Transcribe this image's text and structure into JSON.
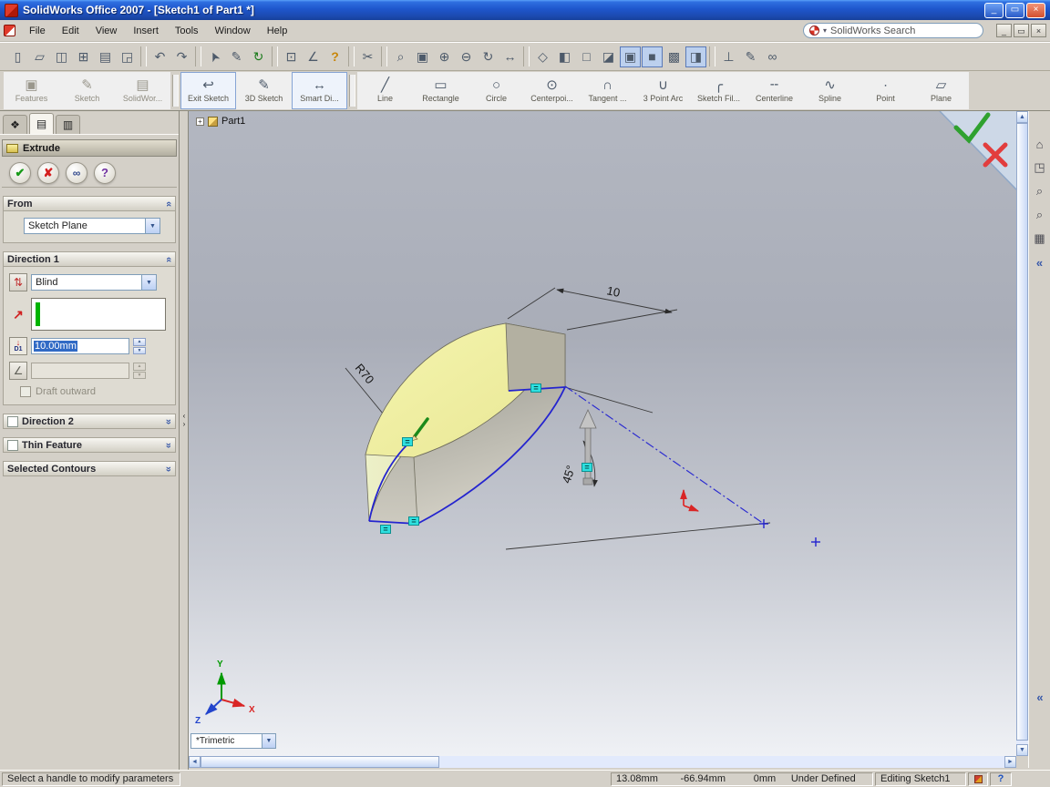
{
  "window": {
    "title": "SolidWorks Office 2007 - [Sketch1 of Part1 *]",
    "buttons": [
      {
        "name": "minimize-button",
        "glyph": "_"
      },
      {
        "name": "restore-button",
        "glyph": "▭"
      },
      {
        "name": "close-button",
        "glyph": "×",
        "cls": "close"
      }
    ]
  },
  "menu": {
    "items": [
      {
        "name": "menu-file",
        "label": "File"
      },
      {
        "name": "menu-edit",
        "label": "Edit"
      },
      {
        "name": "menu-view",
        "label": "View"
      },
      {
        "name": "menu-insert",
        "label": "Insert"
      },
      {
        "name": "menu-tools",
        "label": "Tools"
      },
      {
        "name": "menu-window",
        "label": "Window"
      },
      {
        "name": "menu-help",
        "label": "Help"
      }
    ]
  },
  "search": {
    "label": "SolidWorks Search",
    "arrow": "▾"
  },
  "mdi": {
    "buttons": [
      {
        "name": "mdi-minimize-button",
        "glyph": "_"
      },
      {
        "name": "mdi-restore-button",
        "glyph": "▭"
      },
      {
        "name": "mdi-close-button",
        "glyph": "×"
      }
    ]
  },
  "toolbar_main": {
    "icons": [
      {
        "name": "new-document-icon",
        "glyph": "▯"
      },
      {
        "name": "open-folder-icon",
        "glyph": "▱"
      },
      {
        "name": "save-icon",
        "glyph": "◫"
      },
      {
        "name": "save-all-icon",
        "glyph": "⊞"
      },
      {
        "name": "print-icon",
        "glyph": "▤"
      },
      {
        "name": "print-preview-icon",
        "glyph": "◲"
      },
      {
        "name": "separator",
        "sep": true
      },
      {
        "name": "undo-icon",
        "glyph": "↶"
      },
      {
        "name": "redo-icon",
        "glyph": "↷"
      },
      {
        "name": "separator",
        "sep": true
      },
      {
        "name": "select-pointer-icon",
        "glyph": "➤",
        "cls": "rotl"
      },
      {
        "name": "sketch-entity-icon",
        "glyph": "✎"
      },
      {
        "name": "rebuild-icon",
        "glyph": "↻",
        "cls": "green"
      },
      {
        "name": "separator",
        "sep": true
      },
      {
        "name": "options-icon",
        "glyph": "⊡"
      },
      {
        "name": "dimension-icon",
        "glyph": "∠"
      },
      {
        "name": "quick-help-icon",
        "glyph": "?",
        "cls": "gold"
      },
      {
        "name": "separator",
        "sep": true
      },
      {
        "name": "trim-icon",
        "glyph": "✂"
      },
      {
        "name": "separator",
        "sep": true
      },
      {
        "name": "zoom-fit-icon",
        "glyph": "⌕"
      },
      {
        "name": "zoom-area-icon",
        "glyph": "▣"
      },
      {
        "name": "zoom-in-icon",
        "glyph": "⊕"
      },
      {
        "name": "zoom-out-icon",
        "glyph": "⊖"
      },
      {
        "name": "rotate-view-icon",
        "glyph": "↻"
      },
      {
        "name": "pan-icon",
        "glyph": "↔"
      },
      {
        "name": "separator",
        "sep": true
      },
      {
        "name": "view-orientation-icon",
        "glyph": "◇"
      },
      {
        "name": "standard-views-icon",
        "glyph": "◧"
      },
      {
        "name": "wireframe-icon",
        "glyph": "□"
      },
      {
        "name": "hidden-lines-icon",
        "glyph": "◪"
      },
      {
        "name": "shaded-with-edges-icon",
        "glyph": "▣",
        "cls": "pressed"
      },
      {
        "name": "shaded-icon",
        "glyph": "■",
        "cls": "pressed"
      },
      {
        "name": "shadows-icon",
        "glyph": "▩"
      },
      {
        "name": "section-view-icon",
        "glyph": "◨",
        "cls": "pressed"
      },
      {
        "name": "separator",
        "sep": true
      },
      {
        "name": "normal-to-icon",
        "glyph": "⊥"
      },
      {
        "name": "annotations-icon",
        "glyph": "✎"
      },
      {
        "name": "eyeglasses-icon",
        "glyph": "∞"
      }
    ]
  },
  "toolbar_sketch": {
    "buttons": [
      {
        "name": "features-button",
        "label": "Features",
        "glyph": "▣"
      },
      {
        "name": "sketch-button",
        "label": "Sketch",
        "glyph": "✎"
      },
      {
        "name": "solidworks-office-button",
        "label": "SolidWor...",
        "glyph": "▤"
      },
      {
        "name": "separator",
        "sep": true
      },
      {
        "name": "exit-sketch-button",
        "label": "Exit Sketch",
        "glyph": "↩",
        "cls": "enabled pressed"
      },
      {
        "name": "3d-sketch-button",
        "label": "3D Sketch",
        "glyph": "✎",
        "cls": "enabled"
      },
      {
        "name": "smart-dimension-button",
        "label": "Smart Di...",
        "glyph": "↔",
        "cls": "enabled pressed"
      },
      {
        "name": "separator",
        "sep": true
      },
      {
        "name": "line-button",
        "label": "Line",
        "glyph": "╱",
        "cls": "enabled"
      },
      {
        "name": "rectangle-button",
        "label": "Rectangle",
        "glyph": "▭",
        "cls": "enabled"
      },
      {
        "name": "circle-button",
        "label": "Circle",
        "glyph": "○",
        "cls": "enabled"
      },
      {
        "name": "centerpoint-arc-button",
        "label": "Centerpoi...",
        "glyph": "⊙",
        "cls": "enabled"
      },
      {
        "name": "tangent-arc-button",
        "label": "Tangent ...",
        "glyph": "∩",
        "cls": "enabled"
      },
      {
        "name": "3-point-arc-button",
        "label": "3 Point Arc",
        "glyph": "∪",
        "cls": "enabled"
      },
      {
        "name": "sketch-fillet-button",
        "label": "Sketch Fil...",
        "glyph": "╭",
        "cls": "enabled"
      },
      {
        "name": "centerline-button",
        "label": "Centerline",
        "glyph": "╌",
        "cls": "enabled"
      },
      {
        "name": "spline-button",
        "label": "Spline",
        "glyph": "∿",
        "cls": "enabled"
      },
      {
        "name": "point-button",
        "label": "Point",
        "glyph": "∙",
        "cls": "enabled"
      },
      {
        "name": "plane-button",
        "label": "Plane",
        "glyph": "▱",
        "cls": "enabled"
      }
    ]
  },
  "property_manager": {
    "title": "Extrude",
    "chevron": "«",
    "tabs": [
      {
        "name": "tab-third-party",
        "glyph": "❖",
        "cls": "t1"
      },
      {
        "name": "tab-property-manager",
        "glyph": "▤",
        "cls": "t2 active"
      },
      {
        "name": "tab-configuration-manager",
        "glyph": "▥",
        "cls": "t3"
      }
    ],
    "actions": [
      {
        "name": "ok-button",
        "glyph": "✔",
        "cls": "ok"
      },
      {
        "name": "cancel-button",
        "glyph": "✘",
        "cls": "cancel"
      },
      {
        "name": "detailed-preview-button",
        "glyph": "∞",
        "cls": "preview"
      },
      {
        "name": "help-button",
        "glyph": "?",
        "cls": "help"
      }
    ],
    "groups": {
      "from": {
        "label": "From",
        "value": "Sketch Plane"
      },
      "direction1": {
        "label": "Direction 1",
        "end_condition": "Blind",
        "reverse_icon": "⇅",
        "direction_arrow": "↗",
        "depth_icon_arrow": "↓",
        "depth_icon": "D1",
        "depth": "10.00mm",
        "draft_icon": "∠",
        "draft_checkbox": "Draft outward"
      },
      "direction2": {
        "label": "Direction 2"
      },
      "thin_feature": {
        "label": "Thin Feature"
      },
      "selected_contours": {
        "label": "Selected Contours"
      }
    }
  },
  "feature_tree": {
    "root": "Part1",
    "expander": "+"
  },
  "viewport": {
    "view_selector": "*Trimetric",
    "dimensions": {
      "depth": "10",
      "radius": "R70",
      "angle": "45°"
    },
    "axes": {
      "x": "X",
      "y": "Y",
      "z": "Z"
    }
  },
  "right_rail": {
    "icons": [
      {
        "name": "home-icon",
        "glyph": "⌂"
      },
      {
        "name": "view-cube-icon",
        "glyph": "◳"
      },
      {
        "name": "zoom-sheet-icon",
        "glyph": "⌕"
      },
      {
        "name": "magnifier-icon",
        "glyph": "⌕"
      },
      {
        "name": "grid-icon",
        "glyph": "▦"
      },
      {
        "name": "collapse-panel-icon",
        "glyph": "«",
        "cls": "chev-blue"
      }
    ],
    "bottom_chevron": "«"
  },
  "scrollbar": {
    "up": "▲",
    "down": "▼",
    "left": "◄",
    "right": "►"
  },
  "splitter": {
    "left": "‹",
    "right": "›"
  },
  "status_bar": {
    "message": "Select a handle to modify parameters",
    "x": "13.08mm",
    "y": "-66.94mm",
    "z": "0mm",
    "definition": "Under Defined",
    "mode": "Editing Sketch1",
    "help": "?"
  },
  "colors": {
    "accent_blue": "#316ac5",
    "preview_yellow": "#f2f2a6",
    "sketch_blue": "#2424cf",
    "relation_cyan": "#2ee0e0"
  }
}
